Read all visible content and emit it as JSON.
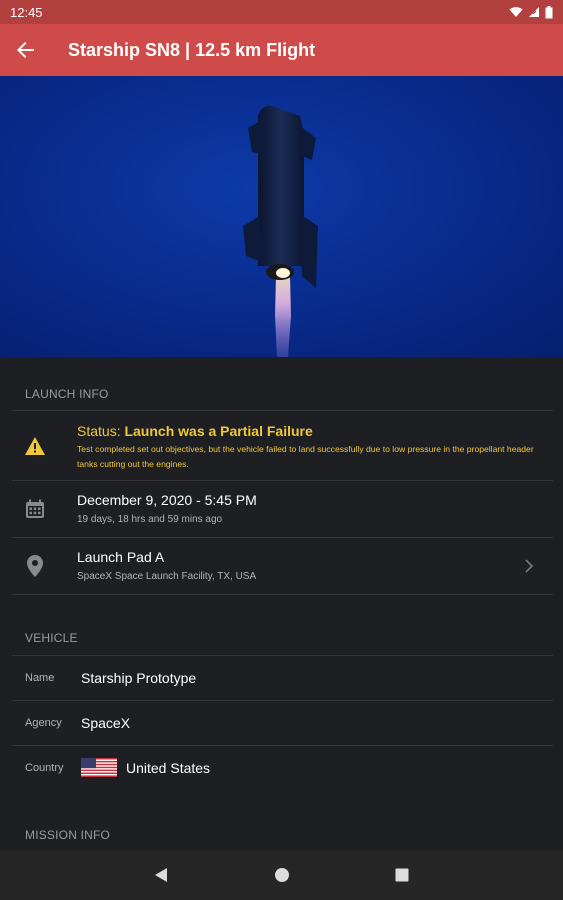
{
  "status_bar": {
    "time": "12:45"
  },
  "app_bar": {
    "title": "Starship SN8 | 12.5 km Flight"
  },
  "launch_info": {
    "header": "LAUNCH INFO",
    "status_prefix": "Status: ",
    "status_value": "Launch was a Partial Failure",
    "status_description": "Test completed set out objectives, but the vehicle failed to land successfully due to low pressure in the propellant header tanks cutting out the engines.",
    "date": "December 9, 2020 - 5:45 PM",
    "date_relative": "19 days, 18 hrs and 59 mins ago",
    "pad_name": "Launch Pad A",
    "pad_location": "SpaceX Space Launch Facility, TX, USA"
  },
  "vehicle": {
    "header": "VEHICLE",
    "name_label": "Name",
    "name_value": "Starship Prototype",
    "agency_label": "Agency",
    "agency_value": "SpaceX",
    "country_label": "Country",
    "country_value": "United States"
  },
  "mission_info": {
    "header": "MISSION INFO"
  },
  "colors": {
    "status_bar": "#b2403f",
    "app_bar": "#cf4b4a",
    "background": "#1e1f22",
    "status_text": "#f1c83b",
    "hero_blue": "#082a8a"
  },
  "icons": {
    "back": "arrow-back-icon",
    "status": "warning-icon",
    "date": "calendar-icon",
    "pad": "location-pin-icon",
    "chevron": "chevron-right-icon"
  }
}
